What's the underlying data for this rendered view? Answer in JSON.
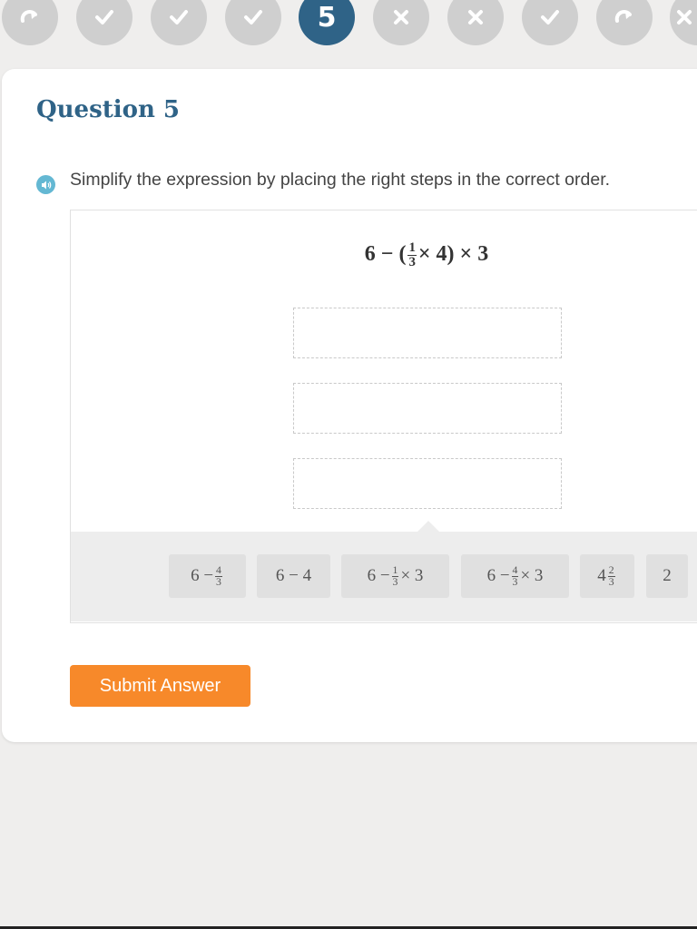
{
  "colors": {
    "page_bg": "#efeeed",
    "accent_blue": "#2f6387",
    "step_gray": "#cfcfcf",
    "submit_orange": "#f7892a",
    "speaker_blue": "#64b8d3"
  },
  "progress": {
    "steps": [
      {
        "status": "skipped",
        "icon": "redo-arrow-icon"
      },
      {
        "status": "correct",
        "icon": "check-icon"
      },
      {
        "status": "correct",
        "icon": "check-icon"
      },
      {
        "status": "correct",
        "icon": "check-icon"
      },
      {
        "status": "current",
        "label": "5"
      },
      {
        "status": "incorrect",
        "icon": "x-icon"
      },
      {
        "status": "incorrect",
        "icon": "x-icon"
      },
      {
        "status": "correct",
        "icon": "check-icon"
      },
      {
        "status": "skipped",
        "icon": "redo-arrow-icon"
      },
      {
        "status": "incorrect",
        "icon": "x-icon"
      }
    ]
  },
  "question": {
    "title": "Question 5",
    "instruction": "Simplify the expression by placing the right steps in the correct order.",
    "expression": {
      "left": "6 − (",
      "frac_num": "1",
      "frac_den": "3",
      "right": "× 4) × 3"
    }
  },
  "answer_slots": 3,
  "tiles": [
    {
      "pre": "6 − ",
      "num": "4",
      "den": "3",
      "post": ""
    },
    {
      "pre": "6 − 4",
      "num": "",
      "den": "",
      "post": ""
    },
    {
      "pre": "6 − ",
      "num": "1",
      "den": "3",
      "post": " × 3"
    },
    {
      "pre": "6 − ",
      "num": "4",
      "den": "3",
      "post": " × 3"
    },
    {
      "pre": "4",
      "num": "2",
      "den": "3",
      "post": ""
    },
    {
      "pre": "2",
      "num": "",
      "den": "",
      "post": ""
    }
  ],
  "submit_label": "Submit Answer"
}
